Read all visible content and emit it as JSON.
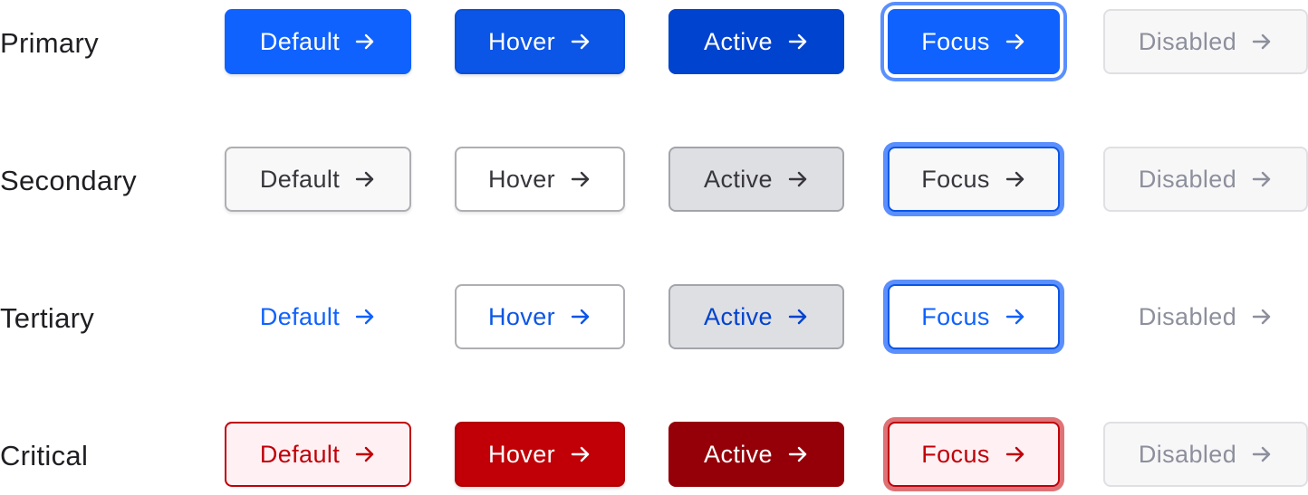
{
  "colors": {
    "primary": "#0f62fe",
    "primary_hover": "#0b56e6",
    "primary_active": "#0043ce",
    "focus_ring": "#5a8ffd",
    "critical": "#c00006",
    "critical_active": "#950008",
    "critical_focus_ring": "#df7276",
    "disabled_text": "#8d8f9c"
  },
  "rows": [
    {
      "label": "Primary",
      "buttons": [
        {
          "state": "Default",
          "icon": "arrow-right-icon"
        },
        {
          "state": "Hover",
          "icon": "arrow-right-icon"
        },
        {
          "state": "Active",
          "icon": "arrow-right-icon"
        },
        {
          "state": "Focus",
          "icon": "arrow-right-icon"
        },
        {
          "state": "Disabled",
          "icon": "arrow-right-icon"
        }
      ]
    },
    {
      "label": "Secondary",
      "buttons": [
        {
          "state": "Default",
          "icon": "arrow-right-icon"
        },
        {
          "state": "Hover",
          "icon": "arrow-right-icon"
        },
        {
          "state": "Active",
          "icon": "arrow-right-icon"
        },
        {
          "state": "Focus",
          "icon": "arrow-right-icon"
        },
        {
          "state": "Disabled",
          "icon": "arrow-right-icon"
        }
      ]
    },
    {
      "label": "Tertiary",
      "buttons": [
        {
          "state": "Default",
          "icon": "arrow-right-icon"
        },
        {
          "state": "Hover",
          "icon": "arrow-right-icon"
        },
        {
          "state": "Active",
          "icon": "arrow-right-icon"
        },
        {
          "state": "Focus",
          "icon": "arrow-right-icon"
        },
        {
          "state": "Disabled",
          "icon": "arrow-right-icon"
        }
      ]
    },
    {
      "label": "Critical",
      "buttons": [
        {
          "state": "Default",
          "icon": "arrow-right-icon"
        },
        {
          "state": "Hover",
          "icon": "arrow-right-icon"
        },
        {
          "state": "Active",
          "icon": "arrow-right-icon"
        },
        {
          "state": "Focus",
          "icon": "arrow-right-icon"
        },
        {
          "state": "Disabled",
          "icon": "arrow-right-icon"
        }
      ]
    }
  ]
}
